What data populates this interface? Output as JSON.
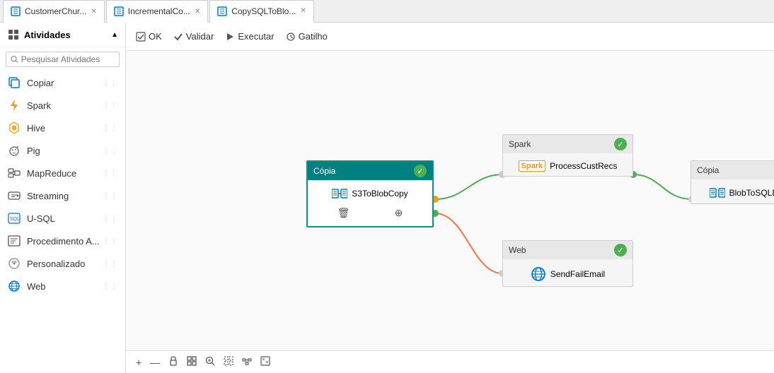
{
  "tabs": [
    {
      "id": "tab1",
      "label": "CustomerChur...",
      "icon": "pipeline-icon",
      "active": false,
      "closable": true
    },
    {
      "id": "tab2",
      "label": "IncrementalCo...",
      "icon": "pipeline-icon",
      "active": false,
      "closable": true
    },
    {
      "id": "tab3",
      "label": "CopySQLToBlo...",
      "icon": "pipeline-icon",
      "active": true,
      "closable": true
    }
  ],
  "toolbar": {
    "ok_label": "OK",
    "validate_label": "Validar",
    "run_label": "Executar",
    "trigger_label": "Gatilho"
  },
  "sidebar": {
    "header_label": "Atividades",
    "search_placeholder": "Pesquisar Atividades",
    "items": [
      {
        "id": "copiar",
        "label": "Copiar",
        "icon": "copy-icon"
      },
      {
        "id": "spark",
        "label": "Spark",
        "icon": "spark-icon"
      },
      {
        "id": "hive",
        "label": "Hive",
        "icon": "hive-icon"
      },
      {
        "id": "pig",
        "label": "Pig",
        "icon": "pig-icon"
      },
      {
        "id": "mapreduce",
        "label": "MapReduce",
        "icon": "mapreduce-icon"
      },
      {
        "id": "streaming",
        "label": "Streaming",
        "icon": "streaming-icon"
      },
      {
        "id": "usql",
        "label": "U-SQL",
        "icon": "usql-icon"
      },
      {
        "id": "procedure",
        "label": "Procedimento A...",
        "icon": "procedure-icon"
      },
      {
        "id": "custom",
        "label": "Personalizado",
        "icon": "custom-icon"
      },
      {
        "id": "web",
        "label": "Web",
        "icon": "web-icon"
      }
    ]
  },
  "nodes": {
    "copia": {
      "header_label": "Cópia",
      "label": "S3ToBlobCopy",
      "status": "check"
    },
    "spark": {
      "header_label": "Spark",
      "label": "ProcessCustRecs",
      "status": "check"
    },
    "web": {
      "header_label": "Web",
      "label": "SendFailEmail",
      "status": "check"
    },
    "copia2": {
      "header_label": "Cópia",
      "label": "BlobToSQLDWCopy",
      "status": "warning"
    }
  },
  "bottom_toolbar": {
    "add_label": "+",
    "remove_label": "—"
  }
}
